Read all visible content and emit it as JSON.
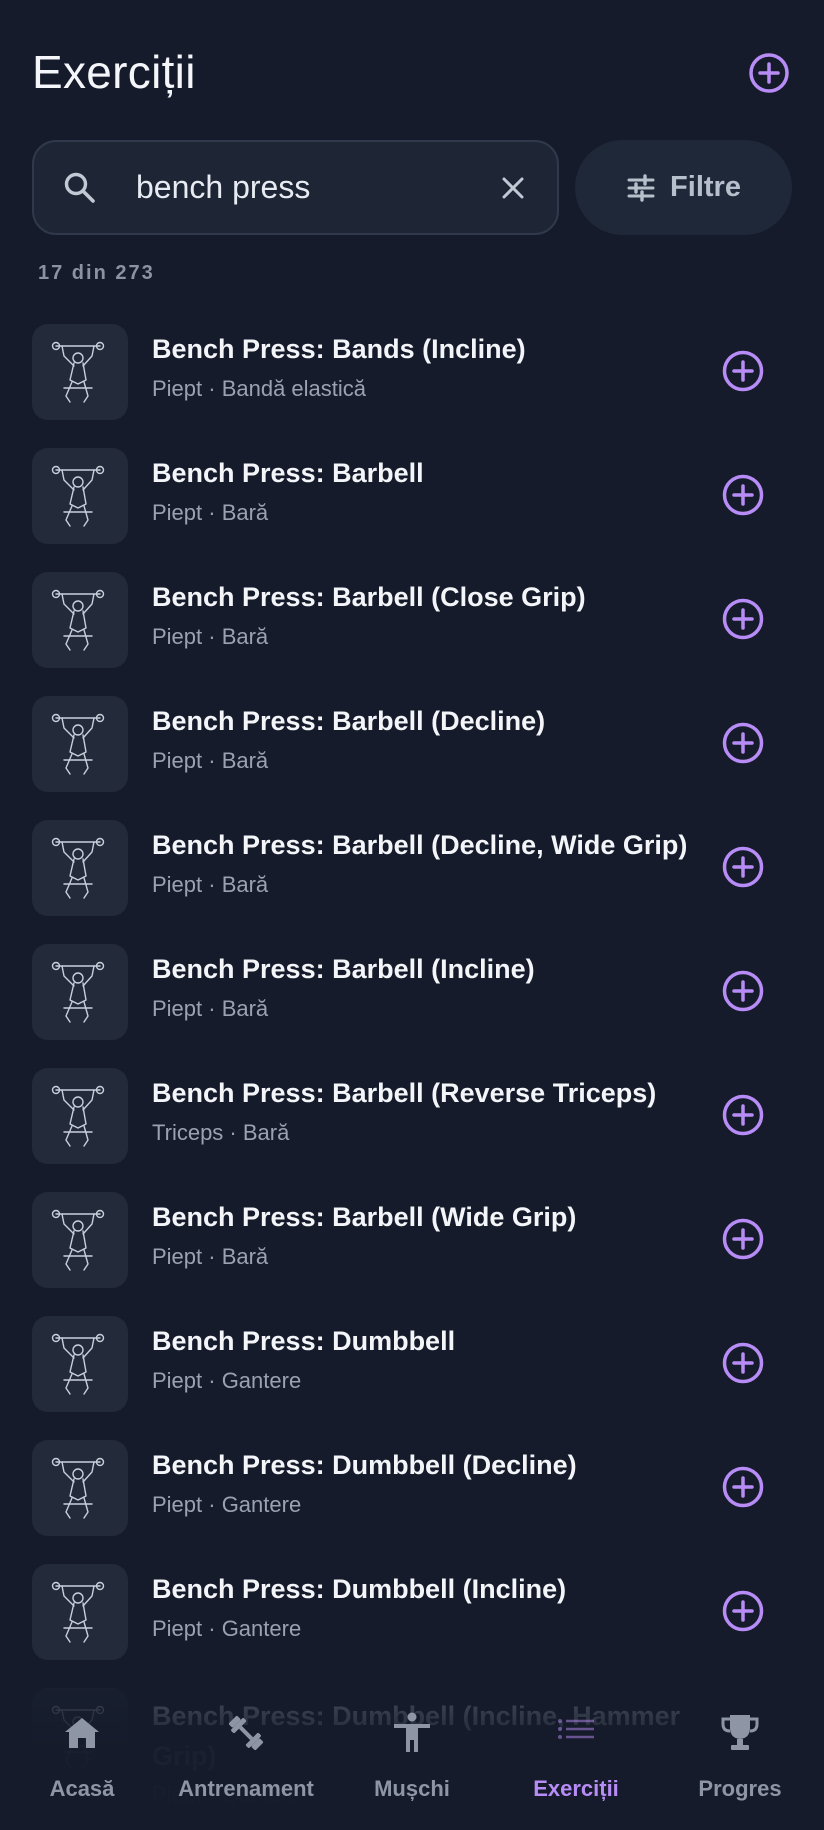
{
  "header": {
    "title": "Exerciții"
  },
  "search": {
    "value": "bench press"
  },
  "filter": {
    "label": "Filtre"
  },
  "results_count": "17 din 273",
  "exercises": [
    {
      "name": "Bench Press: Bands (Incline)",
      "meta": "Piept · Bandă elastică"
    },
    {
      "name": "Bench Press: Barbell",
      "meta": "Piept · Bară"
    },
    {
      "name": "Bench Press: Barbell (Close Grip)",
      "meta": "Piept · Bară"
    },
    {
      "name": "Bench Press: Barbell (Decline)",
      "meta": "Piept · Bară"
    },
    {
      "name": "Bench Press: Barbell (Decline, Wide Grip)",
      "meta": "Piept · Bară"
    },
    {
      "name": "Bench Press: Barbell (Incline)",
      "meta": "Piept · Bară"
    },
    {
      "name": "Bench Press: Barbell (Reverse Triceps)",
      "meta": "Triceps · Bară"
    },
    {
      "name": "Bench Press: Barbell (Wide Grip)",
      "meta": "Piept · Bară"
    },
    {
      "name": "Bench Press: Dumbbell",
      "meta": "Piept · Gantere"
    },
    {
      "name": "Bench Press: Dumbbell (Decline)",
      "meta": "Piept · Gantere"
    },
    {
      "name": "Bench Press: Dumbbell (Incline)",
      "meta": "Piept · Gantere"
    },
    {
      "name": "Bench Press: Dumbbell (Incline, Hammer Grip)",
      "meta": "Piept · Gantere"
    }
  ],
  "nav": {
    "items": [
      {
        "label": "Acasă",
        "icon": "home-icon"
      },
      {
        "label": "Antrenament",
        "icon": "dumbbell-icon"
      },
      {
        "label": "Mușchi",
        "icon": "person-icon"
      },
      {
        "label": "Exerciții",
        "icon": "list-icon",
        "active": true
      },
      {
        "label": "Progres",
        "icon": "trophy-icon"
      }
    ]
  },
  "colors": {
    "background": "#151b2a",
    "accent": "#b88cf6",
    "card": "#232b3a"
  }
}
